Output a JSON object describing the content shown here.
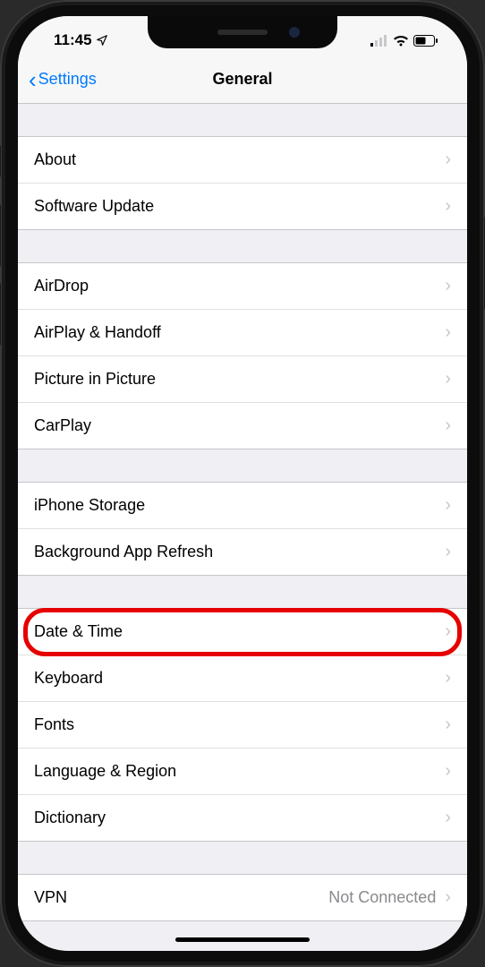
{
  "statusBar": {
    "time": "11:45",
    "locationIcon": "➤"
  },
  "nav": {
    "backLabel": "Settings",
    "title": "General"
  },
  "groups": [
    {
      "rows": [
        {
          "key": "about",
          "label": "About"
        },
        {
          "key": "software-update",
          "label": "Software Update"
        }
      ]
    },
    {
      "rows": [
        {
          "key": "airdrop",
          "label": "AirDrop"
        },
        {
          "key": "airplay-handoff",
          "label": "AirPlay & Handoff"
        },
        {
          "key": "picture-in-picture",
          "label": "Picture in Picture"
        },
        {
          "key": "carplay",
          "label": "CarPlay"
        }
      ]
    },
    {
      "rows": [
        {
          "key": "iphone-storage",
          "label": "iPhone Storage"
        },
        {
          "key": "background-app-refresh",
          "label": "Background App Refresh"
        }
      ]
    },
    {
      "rows": [
        {
          "key": "date-time",
          "label": "Date & Time",
          "highlighted": true
        },
        {
          "key": "keyboard",
          "label": "Keyboard"
        },
        {
          "key": "fonts",
          "label": "Fonts"
        },
        {
          "key": "language-region",
          "label": "Language & Region"
        },
        {
          "key": "dictionary",
          "label": "Dictionary"
        }
      ]
    },
    {
      "rows": [
        {
          "key": "vpn",
          "label": "VPN",
          "detail": "Not Connected"
        }
      ]
    }
  ]
}
